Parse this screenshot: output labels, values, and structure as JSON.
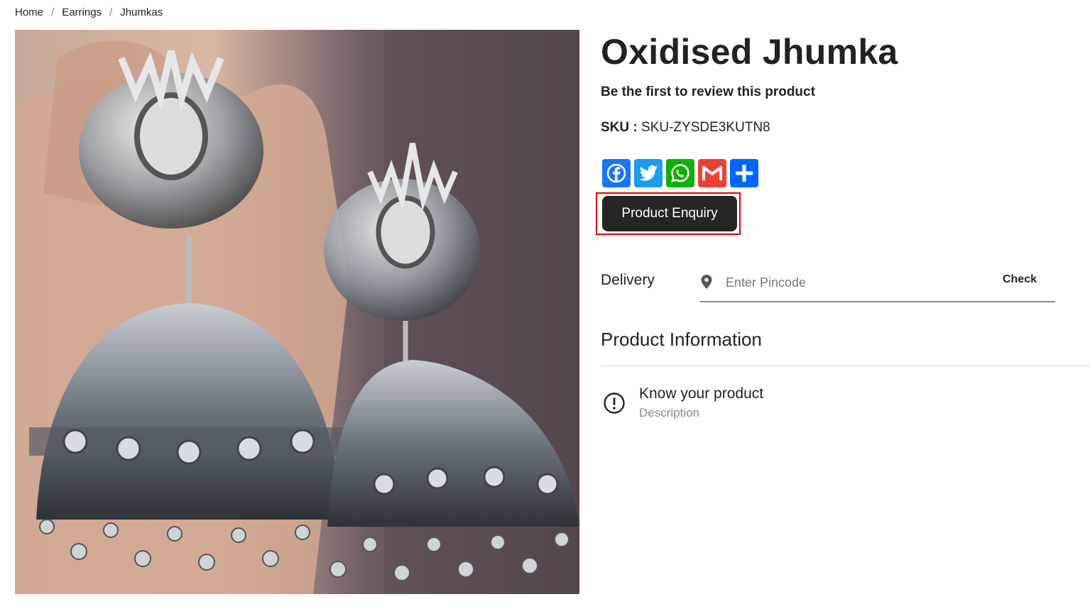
{
  "breadcrumb": {
    "items": [
      "Home",
      "Earrings",
      "Jhumkas"
    ],
    "separator": "/"
  },
  "product": {
    "title": "Oxidised Jhumka",
    "review_text": "Be the first to review this product",
    "sku_label": "SKU :",
    "sku_value": "SKU-ZYSDE3KUTN8"
  },
  "share": {
    "buttons": [
      {
        "icon": "facebook-icon",
        "color": "#1877f2"
      },
      {
        "icon": "twitter-icon",
        "color": "#1d9bf0"
      },
      {
        "icon": "whatsapp-icon",
        "color": "#12af0a"
      },
      {
        "icon": "gmail-icon",
        "color": "#ea4335"
      },
      {
        "icon": "share-icon",
        "color": "#0166ff"
      }
    ]
  },
  "enquiry": {
    "label": "Product Enquiry",
    "highlight_color": "#e00000"
  },
  "delivery": {
    "label": "Delivery",
    "placeholder": "Enter Pincode",
    "value": "",
    "check_label": "Check"
  },
  "product_info": {
    "heading": "Product Information",
    "items": [
      {
        "icon": "info-circle-icon",
        "title": "Know your product",
        "subtitle": "Description"
      }
    ]
  }
}
